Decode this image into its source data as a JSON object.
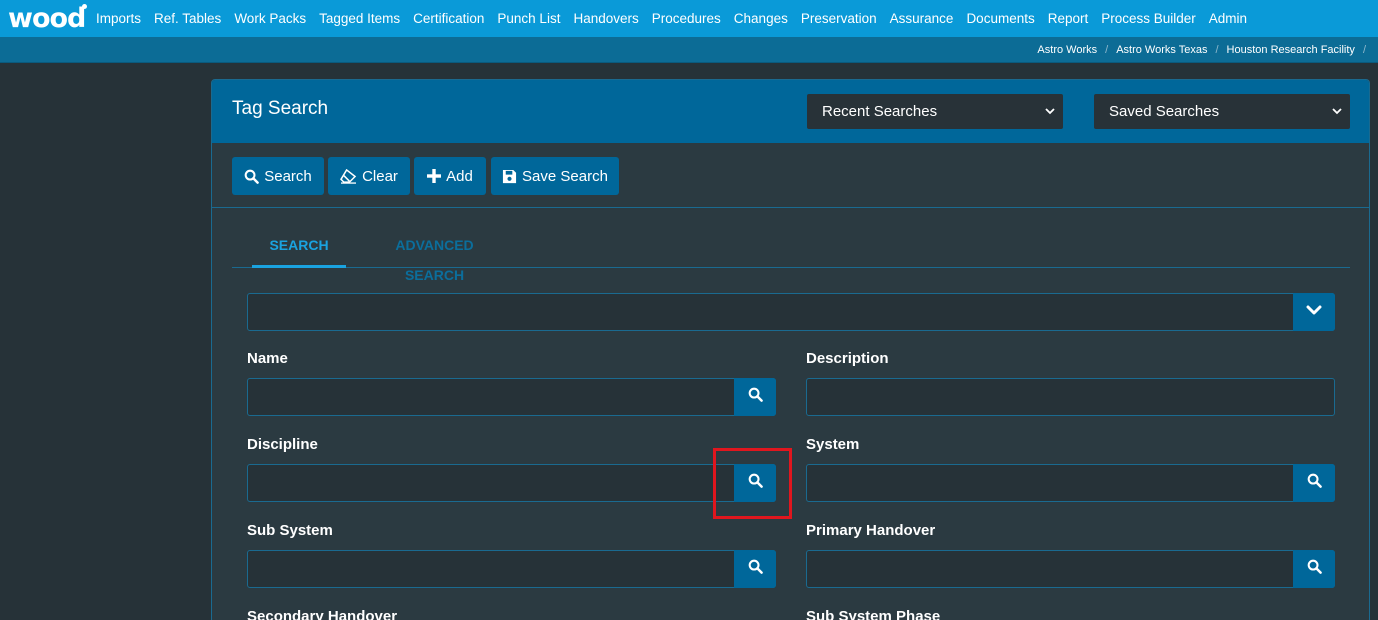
{
  "brand": {
    "logo_text": "wood"
  },
  "nav": {
    "items": [
      "Imports",
      "Ref. Tables",
      "Work Packs",
      "Tagged Items",
      "Certification",
      "Punch List",
      "Handovers",
      "Procedures",
      "Changes",
      "Preservation",
      "Assurance",
      "Documents",
      "Report",
      "Process Builder",
      "Admin"
    ]
  },
  "breadcrumb": [
    "Astro Works",
    "Astro Works Texas",
    "Houston Research Facility"
  ],
  "breadcrumb_separator": "/",
  "panel": {
    "title": "Tag Search",
    "recent_searches": "Recent Searches",
    "saved_searches": "Saved Searches"
  },
  "toolbar": {
    "search_label": "Search",
    "clear_label": "Clear",
    "add_label": "Add",
    "save_search_label": "Save Search"
  },
  "tabs": {
    "search": "SEARCH",
    "advanced": "ADVANCED SEARCH"
  },
  "fields": {
    "name": "Name",
    "description": "Description",
    "discipline": "Discipline",
    "system": "System",
    "sub_system": "Sub System",
    "primary_handover": "Primary Handover",
    "secondary_handover": "Secondary Handover",
    "sub_system_phase": "Sub System Phase"
  },
  "colors": {
    "nav_bg": "#0a9ad8",
    "header_bg": "#00679a",
    "page_bg": "#263238",
    "accent": "#1aa3e0",
    "highlight": "#e0161e"
  },
  "icons": [
    "search-icon",
    "eraser-icon",
    "plus-icon",
    "floppy-disk-icon",
    "chevron-down-icon"
  ]
}
